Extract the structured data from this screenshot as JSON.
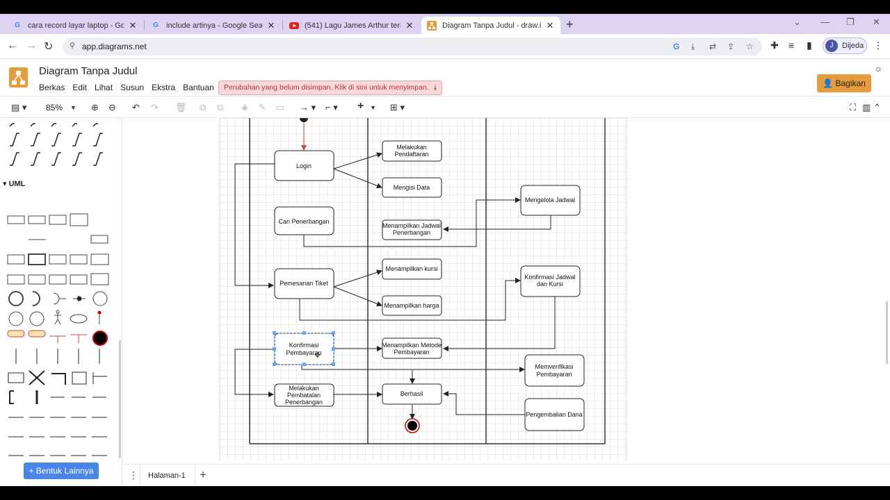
{
  "browser": {
    "tabs": [
      {
        "title": "cara record layar laptop - Googl",
        "icon": "google-icon",
        "active": false
      },
      {
        "title": "include artinya - Google Search",
        "icon": "google-icon",
        "active": false
      },
      {
        "title": "(541) Lagu James Arthur terbaik",
        "icon": "youtube-icon",
        "active": false
      },
      {
        "title": "Diagram Tanpa Judul - draw.io",
        "icon": "drawio-icon",
        "active": true
      }
    ],
    "url": "app.diagrams.net",
    "profile_initial": "J",
    "profile_name": "Dijeda"
  },
  "app": {
    "title": "Diagram Tanpa Judul",
    "menu": [
      "Berkas",
      "Edit",
      "Lihat",
      "Susun",
      "Ekstra",
      "Bantuan"
    ],
    "unsaved_notice": "Perubahan yang belum disimpan. Klik di sini untuk menyimpan.",
    "share_label": "Bagikan",
    "zoom": "85%",
    "sidebar_section": "UML",
    "more_shapes_label": "+ Bentuk Lainnya",
    "page_tab": "Halaman-1"
  },
  "diagram": {
    "nodes": {
      "login": "Login",
      "cari": "Cari Penerbangan",
      "pesan": "Pemesanan Tiket",
      "konfirmasi": "Konfirmasi Pembayaran",
      "batal": "Melakukan Pembatalan Penerbangan",
      "daftar": "Melakukan Pendaftaran",
      "isidata": "Mengisi Data",
      "tampiljadwal": "Menampilkan Jadwal Penerbangan",
      "tampilkursi": "Menampilkan kursi",
      "tampilharga": "Menampilkan harga",
      "tampilmetode": "Menampilkan Metode Pembayaran",
      "berhasil": "Berhasil",
      "kelola": "Mengelola Jadwal",
      "konfjadwal": "Konfirmasi Jadwal dan Kursi",
      "verifikasi": "Memverifikasi Pembayaran",
      "kembali": "Pengembalian Dana"
    }
  }
}
